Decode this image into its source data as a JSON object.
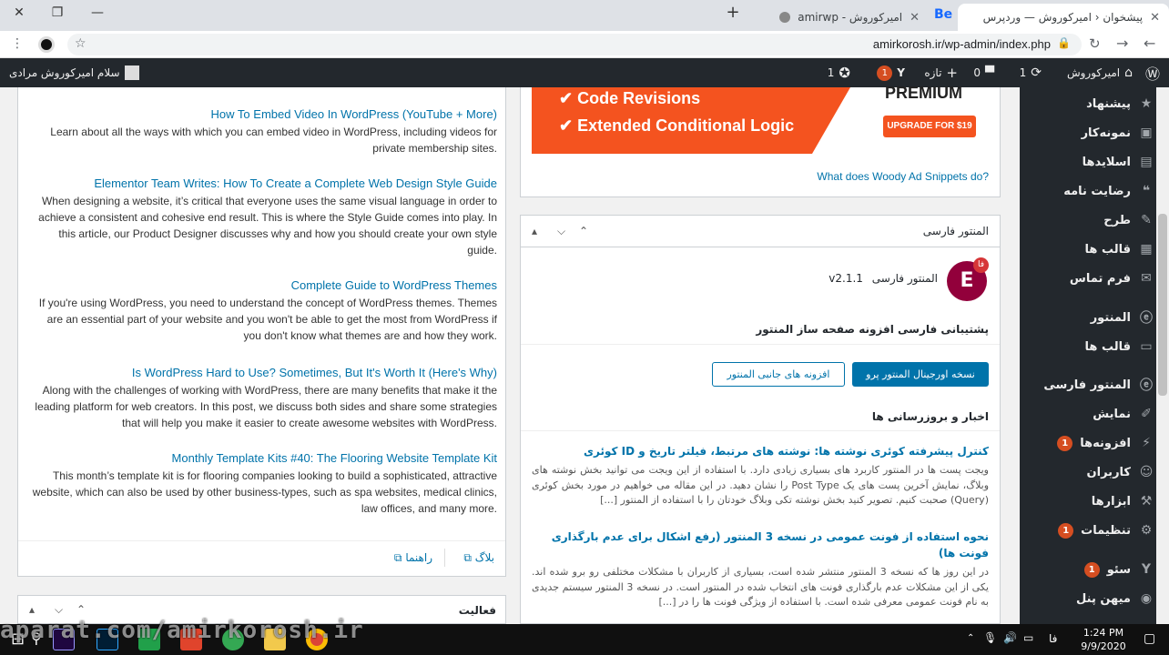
{
  "browser": {
    "tabs": [
      {
        "title": "پیشخوان ‹ امیرکوروش — وردپرس",
        "active": true
      },
      {
        "title": "امیرکوروش - amirwp",
        "active": false
      }
    ],
    "be_tab": "Be",
    "new_tab": "+",
    "url": "amirkorosh.ir/wp-admin/index.php"
  },
  "adminbar": {
    "site_name": "امیرکوروش",
    "updates_count": "1",
    "comments_count": "0",
    "new_label": "تازه",
    "yoast_badge": "1",
    "extra_count": "1",
    "greeting": "سلام امیرکوروش مرادی"
  },
  "sidebar": {
    "items": [
      {
        "label": "پیشنهاد",
        "icon": "lightbulb-icon",
        "glyph": "★"
      },
      {
        "label": "نمونه‌کار",
        "icon": "portfolio-icon",
        "glyph": "▣"
      },
      {
        "label": "اسلایدها",
        "icon": "slides-icon",
        "glyph": "▤"
      },
      {
        "label": "رضایت نامه",
        "icon": "quote-icon",
        "glyph": "❝"
      },
      {
        "label": "طرح",
        "icon": "pen-icon",
        "glyph": "✎"
      },
      {
        "label": "قالب ها",
        "icon": "template-icon",
        "glyph": "▦"
      },
      {
        "label": "فرم تماس",
        "icon": "mail-icon",
        "glyph": "✉"
      },
      {
        "label": "المنتور",
        "icon": "elementor-icon",
        "glyph": "ⓔ"
      },
      {
        "label": "قالب ها",
        "icon": "folder-icon",
        "glyph": "▭"
      },
      {
        "label": "المنتور فارسی",
        "icon": "elementor-fa-icon",
        "glyph": "ⓔ"
      },
      {
        "label": "نمایش",
        "icon": "brush-icon",
        "glyph": "✐"
      },
      {
        "label": "افزونه‌ها",
        "icon": "plugin-icon",
        "glyph": "⚡",
        "badge": "1"
      },
      {
        "label": "کاربران",
        "icon": "user-icon",
        "glyph": "☺"
      },
      {
        "label": "ابزارها",
        "icon": "wrench-icon",
        "glyph": "⚒"
      },
      {
        "label": "تنظیمات",
        "icon": "settings-icon",
        "glyph": "⚙",
        "badge": "1"
      },
      {
        "label": "سئو",
        "icon": "yoast-icon",
        "glyph": "Y",
        "badge": "1"
      },
      {
        "label": "میهن پنل",
        "icon": "mihanpanel-icon",
        "glyph": "◉"
      }
    ]
  },
  "blog": {
    "posts": [
      {
        "title": "How To Embed Video In WordPress (YouTube + More)",
        "excerpt": "Learn about all the ways with which you can embed video in WordPress, including videos for private membership sites."
      },
      {
        "title": "Elementor Team Writes: How To Create a Complete Web Design Style Guide",
        "excerpt": "When designing a website, it’s critical that everyone uses the same visual language in order to achieve a consistent and cohesive end result. This is where the Style Guide comes into play. In this article, our Product Designer discusses why and how you should create your own style guide."
      },
      {
        "title": "Complete Guide to WordPress Themes",
        "excerpt": "If you're using WordPress, you need to understand the concept of WordPress themes. Themes are an essential part of your website and you won't be able to get the most from WordPress if you don't know what themes are and how they work."
      },
      {
        "title": "Is WordPress Hard to Use? Sometimes, But It's Worth It (Here's Why)",
        "excerpt": "Along with the challenges of working with WordPress, there are many benefits that make it the leading platform for web creators. In this post, we discuss both sides and share some strategies that will help you make it easier to create awesome websites with WordPress."
      },
      {
        "title": "Monthly Template Kits #40: The Flooring Website Template Kit",
        "excerpt": "This month’s template kit is for flooring companies looking to build a sophisticated, attractive website, which can also be used by other business-types, such as spa websites, medical clinics, law offices, and many more."
      }
    ],
    "footer_blog": "بلاگ",
    "footer_help": "راهنما"
  },
  "activity_title": "فعالیت",
  "ad": {
    "feature1": "Code Revisions",
    "feature2": "Extended Conditional Logic",
    "premium": "PREMIUM",
    "upgrade": "UPGRADE FOR $19",
    "link": "What does Woody Ad Snippets do?"
  },
  "elementor_fa": {
    "box_title": "المنتور فارسی",
    "plugin_name": "المنتور فارسی",
    "version": "v2.1.1",
    "logo_badge": "فا",
    "tagline": "پشتیبانی فارسی افزونه صفحه ساز المنتور",
    "btn_primary": "نسخه اورجینال المنتور پرو",
    "btn_secondary": "افزونه های جانبی المنتور",
    "news_heading": "اخبار و بروزرسانی ها",
    "news": [
      {
        "title": "کنترل پیشرفته کوئری نوشته ها: نوشته های مرتبط، فیلتر تاریخ و ID کوئری",
        "body": "ویجت پست ها در المنتور کاربرد های بسیاری زیادی دارد. با استفاده از این ویجت می توانید بخش نوشته های وبلاگ، نمایش آخرین پست های یک Post Type را نشان دهید. در این مقاله می خواهیم در مورد بخش کوئری (Query) صحبت کنیم. تصویر کنید بخش نوشته تکی وبلاگ خودتان را با استفاده از المنتور [...]"
      },
      {
        "title": "نحوه استفاده از فونت عمومی در نسخه 3 المنتور (رفع اشکال برای عدم بارگذاری فونت ها)",
        "body": "در این روز ها که نسخه 3 المنتور منتشر شده است، بسیاری از کاربران با مشکلات مختلفی رو برو شده اند. یکی از این مشکلات عدم بارگذاری فونت های انتخاب شده در المنتور است. در نسخه 3 المنتور سیستم جدیدی به نام فونت عمومی معرفی شده است. با استفاده از ویژگی فونت ها را در [...]"
      }
    ]
  },
  "taskbar": {
    "watermark": "aparat.com/amirkorosh.ir",
    "lang": "فا",
    "time": "1:24 PM",
    "date": "9/9/2020"
  },
  "colors": {
    "wp_dark": "#23282d",
    "wp_link": "#0073aa",
    "badge": "#d54e21",
    "elementor": "#92003b",
    "ad_orange": "#f4531f"
  }
}
